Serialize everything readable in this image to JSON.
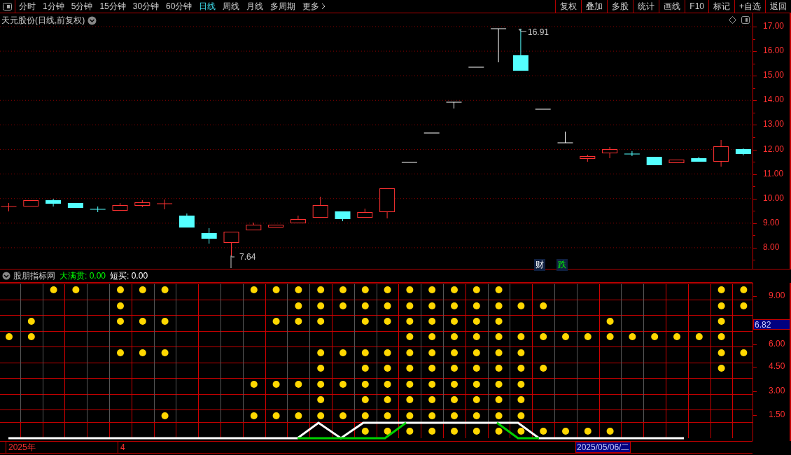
{
  "toolbar": {
    "periods": [
      {
        "label": "分时",
        "selected": false
      },
      {
        "label": "1分钟",
        "selected": false
      },
      {
        "label": "5分钟",
        "selected": false
      },
      {
        "label": "15分钟",
        "selected": false
      },
      {
        "label": "30分钟",
        "selected": false
      },
      {
        "label": "60分钟",
        "selected": false
      },
      {
        "label": "日线",
        "selected": true
      },
      {
        "label": "周线",
        "selected": false
      },
      {
        "label": "月线",
        "selected": false
      },
      {
        "label": "多周期",
        "selected": false
      },
      {
        "label": "更多",
        "selected": false
      }
    ],
    "actions": [
      "复权",
      "叠加",
      "多股",
      "统计",
      "画线",
      "F10",
      "标记",
      "+自选",
      "返回"
    ]
  },
  "main_chart": {
    "title": "天元股份(日线,前复权)",
    "y_ticks": [
      "17.00",
      "16.00",
      "15.00",
      "14.00",
      "13.00",
      "12.00",
      "11.00",
      "10.00",
      "9.00",
      "8.00"
    ],
    "high_label": "16.91",
    "low_label": "7.64",
    "markers": [
      {
        "label": "财",
        "kind": "finance"
      },
      {
        "label": "跌",
        "kind": "fall"
      }
    ]
  },
  "indicator": {
    "name": "股朋指标网",
    "values": [
      {
        "label": "大满贯: 0.00",
        "kind": "signal"
      },
      {
        "label": "短买: 0.00",
        "kind": "plain"
      }
    ],
    "y_ticks": [
      "9.00",
      "6.00",
      "4.50",
      "3.00",
      "1.50"
    ],
    "current_value": "6.82"
  },
  "time_axis": {
    "labels": [
      "2025年",
      "4"
    ],
    "cursor_date": "2025/05/06/二"
  }
}
